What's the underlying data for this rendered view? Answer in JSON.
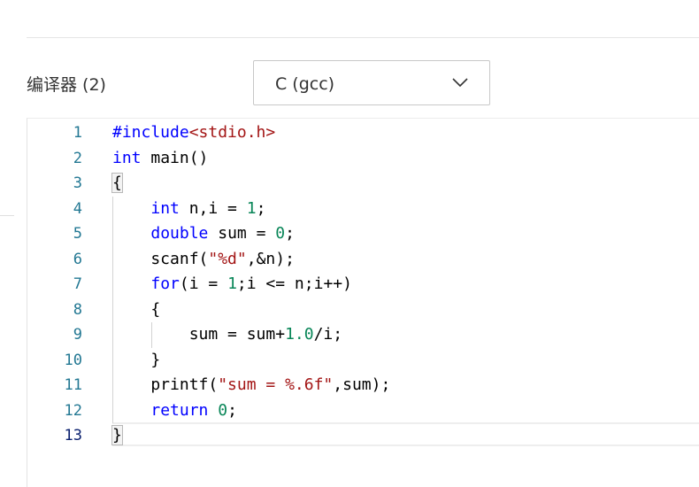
{
  "compiler": {
    "label": "编译器 (2)",
    "selected": "C (gcc)",
    "chevron_icon": "chevron-down-icon"
  },
  "editor": {
    "current_line": 13,
    "line_numbers": [
      "1",
      "2",
      "3",
      "4",
      "5",
      "6",
      "7",
      "8",
      "9",
      "10",
      "11",
      "12",
      "13"
    ],
    "lines": [
      [
        {
          "t": "#include",
          "c": "prep"
        },
        {
          "t": "<stdio.h>",
          "c": "inc"
        }
      ],
      [
        {
          "t": "int",
          "c": "kw"
        },
        {
          "t": " main()",
          "c": ""
        }
      ],
      [
        {
          "t": "{",
          "c": "brace-open"
        }
      ],
      [
        {
          "t": "    ",
          "c": ""
        },
        {
          "t": "int",
          "c": "kw"
        },
        {
          "t": " n,i = ",
          "c": ""
        },
        {
          "t": "1",
          "c": "num"
        },
        {
          "t": ";",
          "c": ""
        }
      ],
      [
        {
          "t": "    ",
          "c": ""
        },
        {
          "t": "double",
          "c": "kw"
        },
        {
          "t": " sum = ",
          "c": ""
        },
        {
          "t": "0",
          "c": "num"
        },
        {
          "t": ";",
          "c": ""
        }
      ],
      [
        {
          "t": "    scanf(",
          "c": ""
        },
        {
          "t": "\"%d\"",
          "c": "str"
        },
        {
          "t": ",&n);",
          "c": ""
        }
      ],
      [
        {
          "t": "    ",
          "c": ""
        },
        {
          "t": "for",
          "c": "kw"
        },
        {
          "t": "(i = ",
          "c": ""
        },
        {
          "t": "1",
          "c": "num"
        },
        {
          "t": ";i <= n;i++)",
          "c": ""
        }
      ],
      [
        {
          "t": "    {",
          "c": ""
        }
      ],
      [
        {
          "t": "        sum = sum+",
          "c": ""
        },
        {
          "t": "1.0",
          "c": "num"
        },
        {
          "t": "/i;",
          "c": ""
        }
      ],
      [
        {
          "t": "    }",
          "c": ""
        }
      ],
      [
        {
          "t": "    printf(",
          "c": ""
        },
        {
          "t": "\"sum = %.6f\"",
          "c": "str"
        },
        {
          "t": ",sum);",
          "c": ""
        }
      ],
      [
        {
          "t": "    ",
          "c": ""
        },
        {
          "t": "return",
          "c": "kw"
        },
        {
          "t": " ",
          "c": ""
        },
        {
          "t": "0",
          "c": "num"
        },
        {
          "t": ";",
          "c": ""
        }
      ],
      [
        {
          "t": "}",
          "c": "brace-close"
        }
      ]
    ]
  },
  "colors": {
    "keyword": "#0000ff",
    "number": "#098658",
    "string": "#a31515",
    "line_number": "#237893",
    "active_line_number": "#0b216f"
  }
}
